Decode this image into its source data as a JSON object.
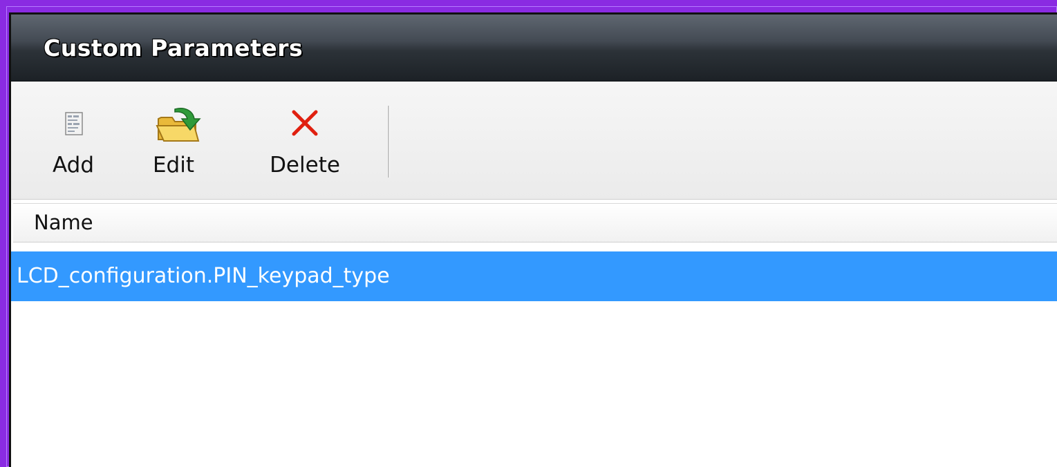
{
  "window": {
    "title": "Custom Parameters"
  },
  "toolbar": {
    "add": {
      "label": "Add",
      "icon": "document-icon"
    },
    "edit": {
      "label": "Edit",
      "icon": "folder-arrow-icon"
    },
    "delete": {
      "label": "Delete",
      "icon": "close-icon"
    }
  },
  "table": {
    "columns": [
      "Name"
    ],
    "rows": [
      {
        "name": "LCD_configuration.PIN_keypad_type",
        "selected": true
      }
    ]
  },
  "colors": {
    "selection": "#3399ff",
    "delete_icon": "#e02010",
    "frame_border": "#8a2be2"
  }
}
